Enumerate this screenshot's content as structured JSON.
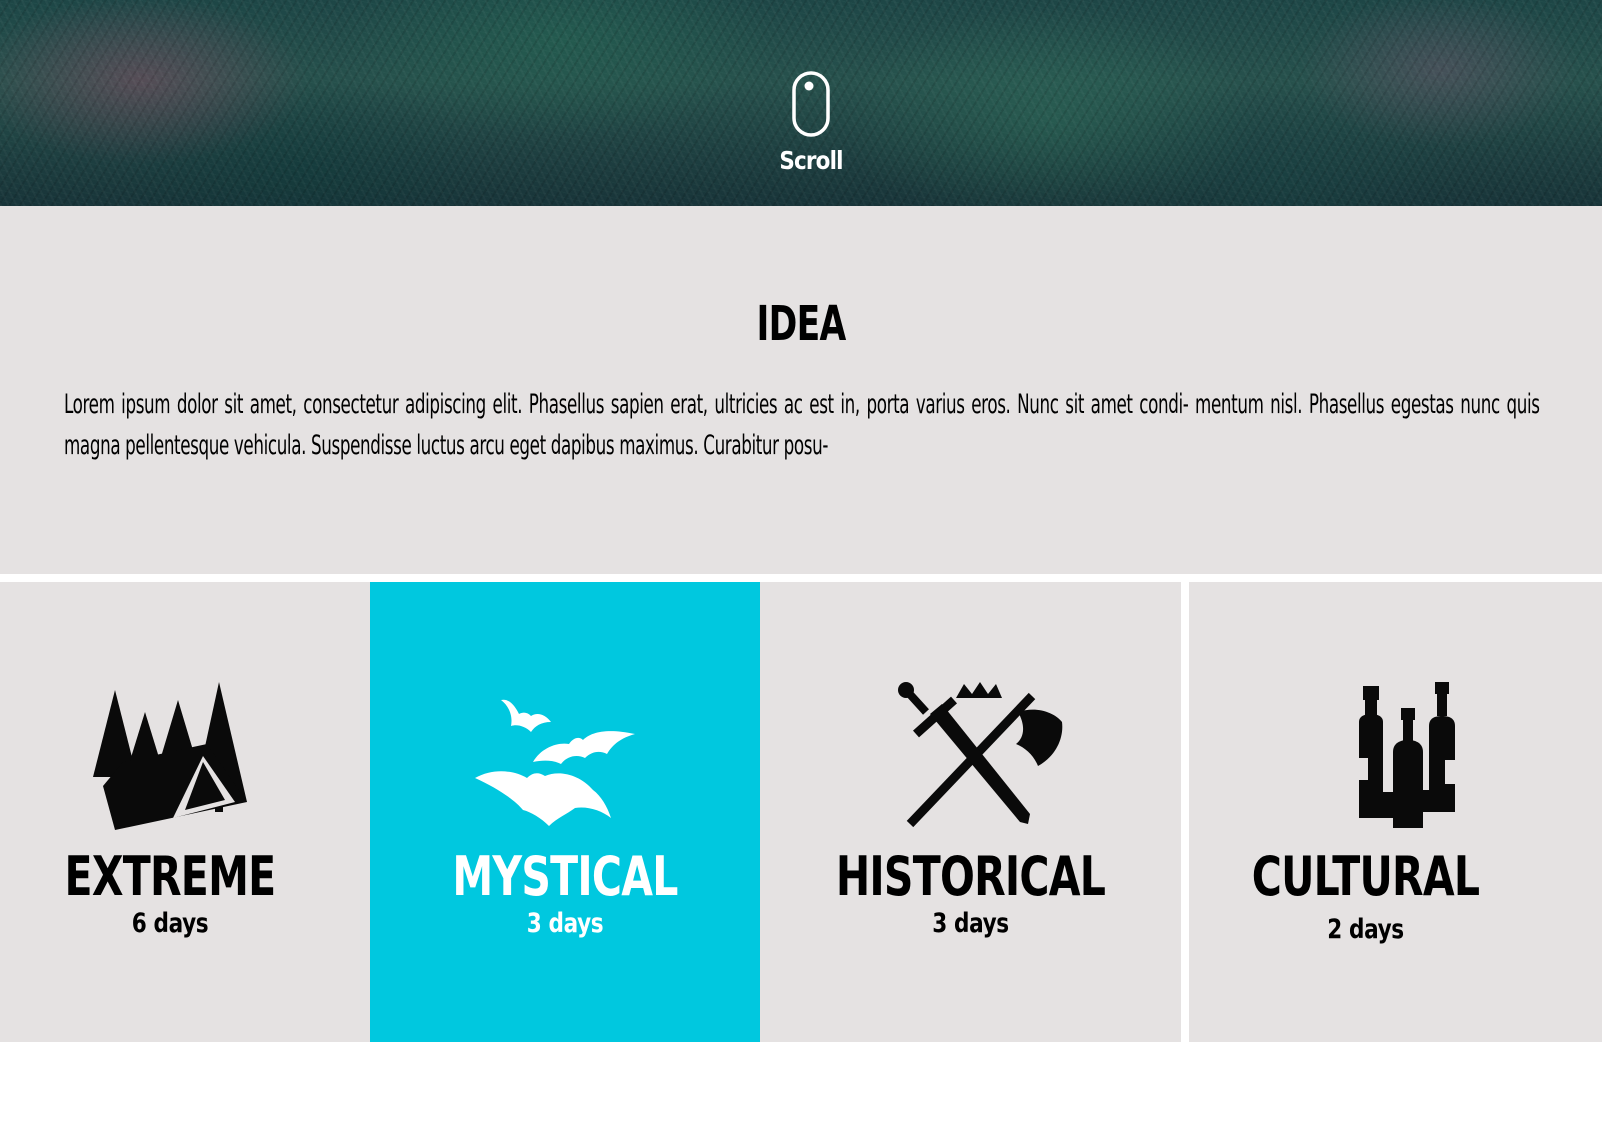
{
  "hero": {
    "scroll_label": "Scroll",
    "mouse_icon": "mouse-icon"
  },
  "intro": {
    "title": "IDEA",
    "text": "Lorem ipsum dolor sit amet, consectetur adipiscing elit. Phasellus sapien erat, ultricies ac est in, porta varius eros. Nunc sit amet condi- mentum nisl. Phasellus egestas nunc quis magna pellentesque vehicula. Suspendisse luctus arcu eget dapibus maximus. Curabitur posu-"
  },
  "categories": [
    {
      "name": "EXTREME",
      "duration": "6 days",
      "icon": "tent-forest-icon",
      "active": false
    },
    {
      "name": "MYSTICAL",
      "duration": "3 days",
      "icon": "bats-icon",
      "active": true
    },
    {
      "name": "HISTORICAL",
      "duration": "3 days",
      "icon": "crossed-weapons-icon",
      "active": false
    },
    {
      "name": "CULTURAL",
      "duration": "2 days",
      "icon": "wine-bottles-icon",
      "active": false
    }
  ],
  "colors": {
    "accent": "#00c8df",
    "panel": "#e5e2e2",
    "text": "#000000"
  }
}
